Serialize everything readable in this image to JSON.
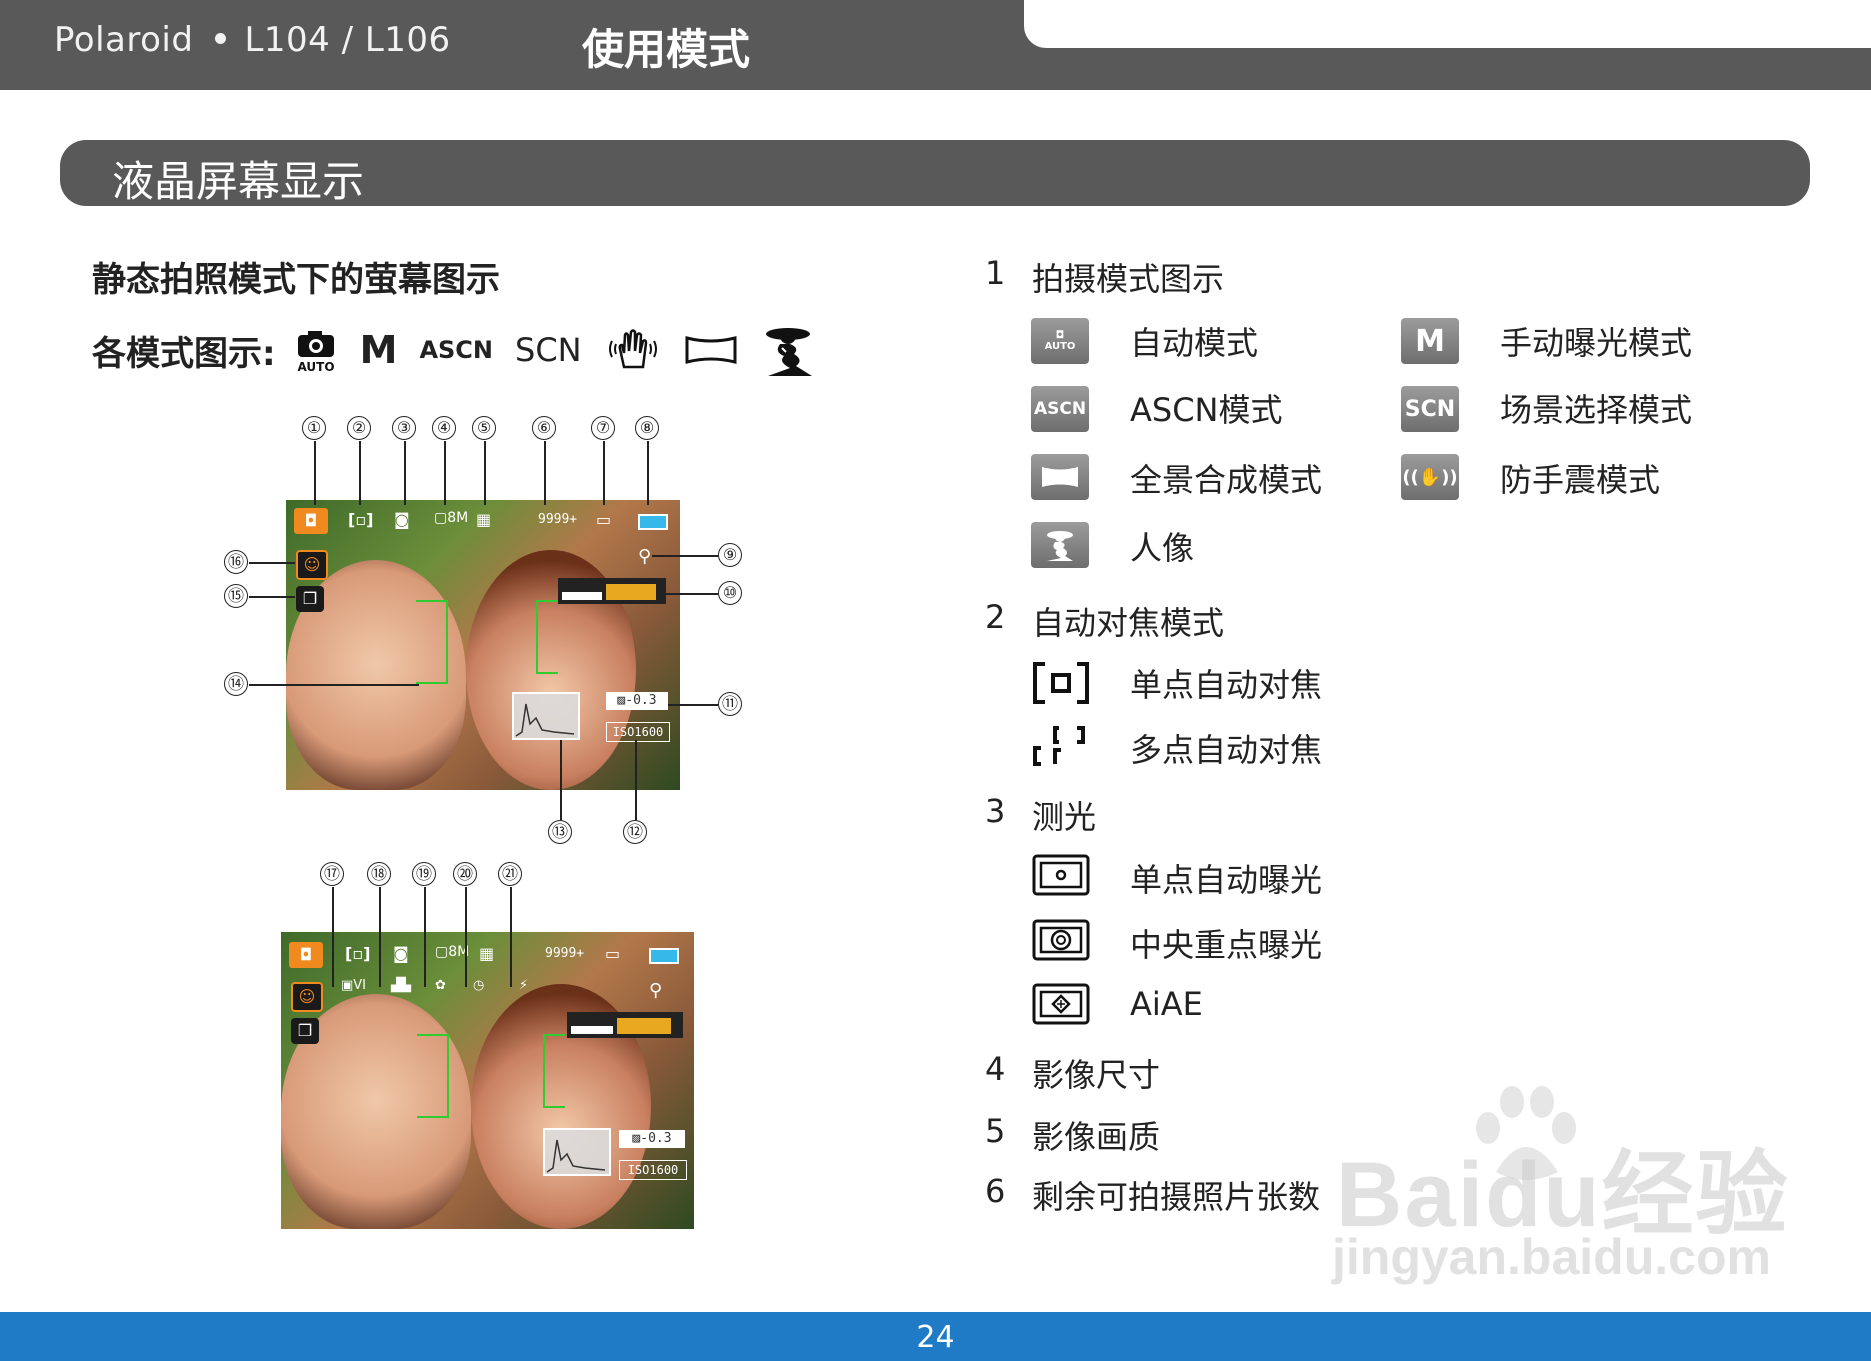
{
  "header": {
    "brand": "Polaroid",
    "model": "L104 / L106",
    "chapter": "使用模式"
  },
  "section": {
    "title": "液晶屏幕显示"
  },
  "left": {
    "subtitle": "静态拍照模式下的萤幕图示",
    "modes_label": "各模式图示:",
    "mode_icons": [
      "camera-auto-icon",
      "manual-m-icon",
      "ascn-icon",
      "scn-icon",
      "anti-shake-hand-icon",
      "panorama-icon",
      "portrait-icon"
    ],
    "mode_icon_texts": {
      "auto": "AUTO",
      "m": "M",
      "ascn": "ASCN",
      "scn": "SCN"
    },
    "screen1": {
      "top_callouts": [
        "①",
        "②",
        "③",
        "④",
        "⑤",
        "⑥",
        "⑦",
        "⑧"
      ],
      "side_callouts": [
        "⑨",
        "⑩",
        "⑪",
        "⑫",
        "⑬",
        "⑭",
        "⑮",
        "⑯"
      ],
      "shots_remaining": "9999+",
      "ev": "-0.3",
      "iso": "ISO1600"
    },
    "screen2": {
      "top_callouts": [
        "⑰",
        "⑱",
        "⑲",
        "⑳",
        "㉑"
      ],
      "shots_remaining": "9999+",
      "ev": "-0.3",
      "iso": "ISO1600"
    }
  },
  "right": {
    "sections": [
      {
        "num": "1",
        "title": "拍摄模式图示"
      },
      {
        "num": "2",
        "title": "自动对焦模式"
      },
      {
        "num": "3",
        "title": "测光"
      },
      {
        "num": "4",
        "title": "影像尺寸"
      },
      {
        "num": "5",
        "title": "影像画质"
      },
      {
        "num": "6",
        "title": "剩余可拍摄照片张数"
      }
    ],
    "shooting_modes": [
      {
        "label": "自动模式",
        "icon": "camera-auto-icon",
        "icon_text": "AUTO"
      },
      {
        "label": "手动曝光模式",
        "icon": "manual-m-icon",
        "icon_text": "M"
      },
      {
        "label": "ASCN模式",
        "icon": "ascn-icon",
        "icon_text": "ASCN"
      },
      {
        "label": "场景选择模式",
        "icon": "scn-icon",
        "icon_text": "SCN"
      },
      {
        "label": "全景合成模式",
        "icon": "panorama-icon",
        "icon_text": ""
      },
      {
        "label": "防手震模式",
        "icon": "anti-shake-hand-icon",
        "icon_text": ""
      },
      {
        "label": "人像",
        "icon": "portrait-icon",
        "icon_text": ""
      }
    ],
    "focus_modes": [
      {
        "label": "单点自动对焦",
        "icon": "single-af-icon"
      },
      {
        "label": "多点自动对焦",
        "icon": "multi-af-icon"
      }
    ],
    "metering_modes": [
      {
        "label": "单点自动曝光",
        "icon": "spot-metering-icon"
      },
      {
        "label": "中央重点曝光",
        "icon": "center-metering-icon"
      },
      {
        "label": "AiAE",
        "icon": "aiae-metering-icon"
      }
    ]
  },
  "footer": {
    "page": "24"
  },
  "watermark": {
    "brand": "Baidu经验",
    "url": "jingyan.baidu.com"
  },
  "colors": {
    "header_gray": "#5a595a",
    "footer_blue": "#1f7bc6",
    "osd_orange": "#f08a1e",
    "af_green": "#2ecc2e"
  }
}
